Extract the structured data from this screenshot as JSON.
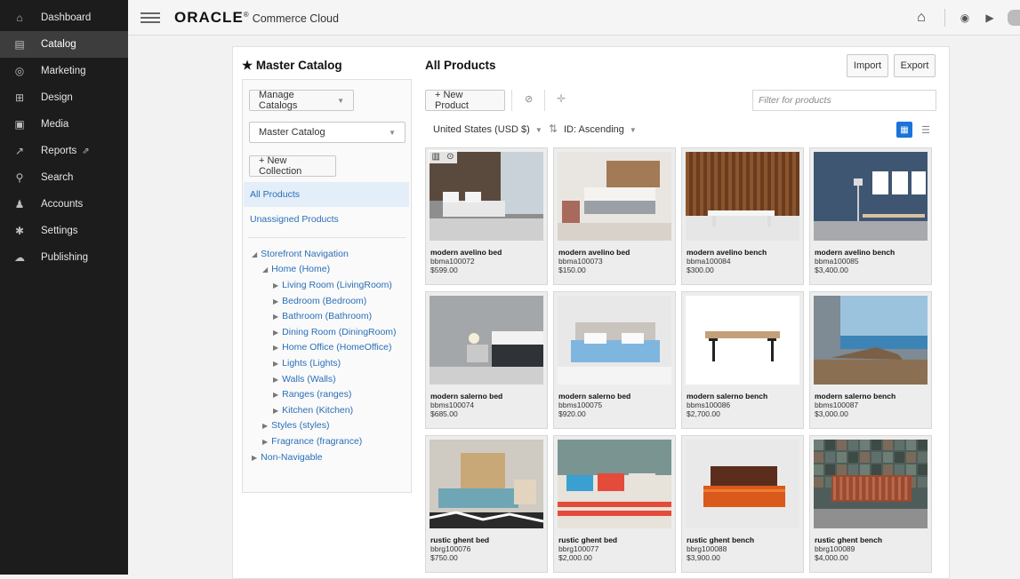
{
  "sidebar": {
    "items": [
      {
        "label": "Dashboard",
        "icon": "home-icon",
        "glyph": "⌂"
      },
      {
        "label": "Catalog",
        "icon": "book-icon",
        "glyph": "▤",
        "active": true
      },
      {
        "label": "Marketing",
        "icon": "target-icon",
        "glyph": "◎"
      },
      {
        "label": "Design",
        "icon": "layout-icon",
        "glyph": "⊞"
      },
      {
        "label": "Media",
        "icon": "film-icon",
        "glyph": "▣"
      },
      {
        "label": "Reports",
        "icon": "chart-icon",
        "glyph": "↗",
        "external": true
      },
      {
        "label": "Search",
        "icon": "search-icon",
        "glyph": "⚲"
      },
      {
        "label": "Accounts",
        "icon": "users-icon",
        "glyph": "♟"
      },
      {
        "label": "Settings",
        "icon": "gear-icon",
        "glyph": "✱"
      },
      {
        "label": "Publishing",
        "icon": "cloud-icon",
        "glyph": "☁"
      }
    ]
  },
  "topbar": {
    "brand": "ORACLE",
    "brand_mark": "®",
    "product": "Commerce Cloud"
  },
  "left_panel": {
    "title": "Master Catalog",
    "manage_catalogs": "Manage Catalogs",
    "catalog_select": "Master Catalog",
    "new_collection": "+ New Collection",
    "collections": [
      "All Products",
      "Unassigned Products"
    ],
    "tree": {
      "root": "Storefront Navigation",
      "home": "Home (Home)",
      "home_children": [
        "Living Room (LivingRoom)",
        "Bedroom (Bedroom)",
        "Bathroom (Bathroom)",
        "Dining Room (DiningRoom)",
        "Home Office (HomeOffice)",
        "Lights (Lights)",
        "Walls (Walls)",
        "Ranges (ranges)",
        "Kitchen (Kitchen)"
      ],
      "siblings": [
        "Styles (styles)",
        "Fragrance (fragrance)"
      ],
      "non_navigable": "Non-Navigable"
    }
  },
  "main": {
    "title": "All Products",
    "import": "Import",
    "export": "Export",
    "new_product": "+ New Product",
    "filter_placeholder": "Filter for products",
    "currency": "United States (USD $)",
    "sort": "ID: Ascending",
    "products": [
      {
        "name": "modern avelino bed",
        "id": "bbma100072",
        "price": "$599.00"
      },
      {
        "name": "modern avelino bed",
        "id": "bbma100073",
        "price": "$150.00"
      },
      {
        "name": "modern avelino bench",
        "id": "bbma100084",
        "price": "$300.00"
      },
      {
        "name": "modern avelino bench",
        "id": "bbma100085",
        "price": "$3,400.00"
      },
      {
        "name": "modern salerno bed",
        "id": "bbms100074",
        "price": "$685.00"
      },
      {
        "name": "modern salerno bed",
        "id": "bbms100075",
        "price": "$920.00"
      },
      {
        "name": "modern salerno bench",
        "id": "bbms100086",
        "price": "$2,700.00"
      },
      {
        "name": "modern salerno bench",
        "id": "bbms100087",
        "price": "$3,000.00"
      },
      {
        "name": "rustic ghent bed",
        "id": "bbrg100076",
        "price": "$750.00"
      },
      {
        "name": "rustic ghent bed",
        "id": "bbrg100077",
        "price": "$2,000.00"
      },
      {
        "name": "rustic ghent bench",
        "id": "bbrg100088",
        "price": "$3,900.00"
      },
      {
        "name": "rustic ghent bench",
        "id": "bbrg100089",
        "price": "$4,000.00"
      }
    ]
  }
}
